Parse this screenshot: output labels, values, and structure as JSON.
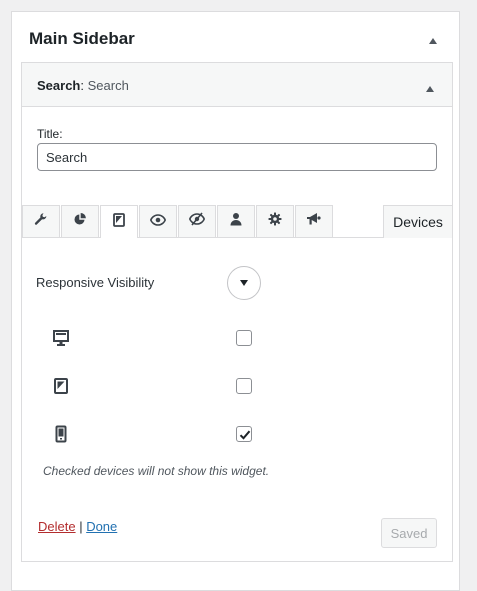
{
  "sidebar": {
    "title": "Main Sidebar"
  },
  "widget": {
    "name": "Search",
    "title_sep": ": ",
    "subtitle": "Search",
    "fields": {
      "title_label": "Title:",
      "title_value": "Search"
    },
    "tabs": [
      {
        "icon": "wrench-icon",
        "active": false
      },
      {
        "icon": "pie-chart-icon",
        "active": false
      },
      {
        "icon": "tablet-icon",
        "active": true
      },
      {
        "icon": "eye-icon",
        "active": false
      },
      {
        "icon": "eye-slash-icon",
        "active": false
      },
      {
        "icon": "user-icon",
        "active": false
      },
      {
        "icon": "gear-icon",
        "active": false
      },
      {
        "icon": "megaphone-icon",
        "active": false
      }
    ],
    "tab_label": "Devices",
    "responsive_label": "Responsive Visibility",
    "devices": [
      {
        "icon": "desktop-icon",
        "checked": false
      },
      {
        "icon": "tablet-icon",
        "checked": false
      },
      {
        "icon": "mobile-icon",
        "checked": true
      }
    ],
    "note": "Checked devices will not show this widget.",
    "actions": {
      "delete": "Delete",
      "separator": " | ",
      "done": "Done",
      "saved": "Saved"
    }
  },
  "colors": {
    "accent": "#2271b1",
    "delete": "#b32d2e",
    "icon": "#3c434a"
  }
}
